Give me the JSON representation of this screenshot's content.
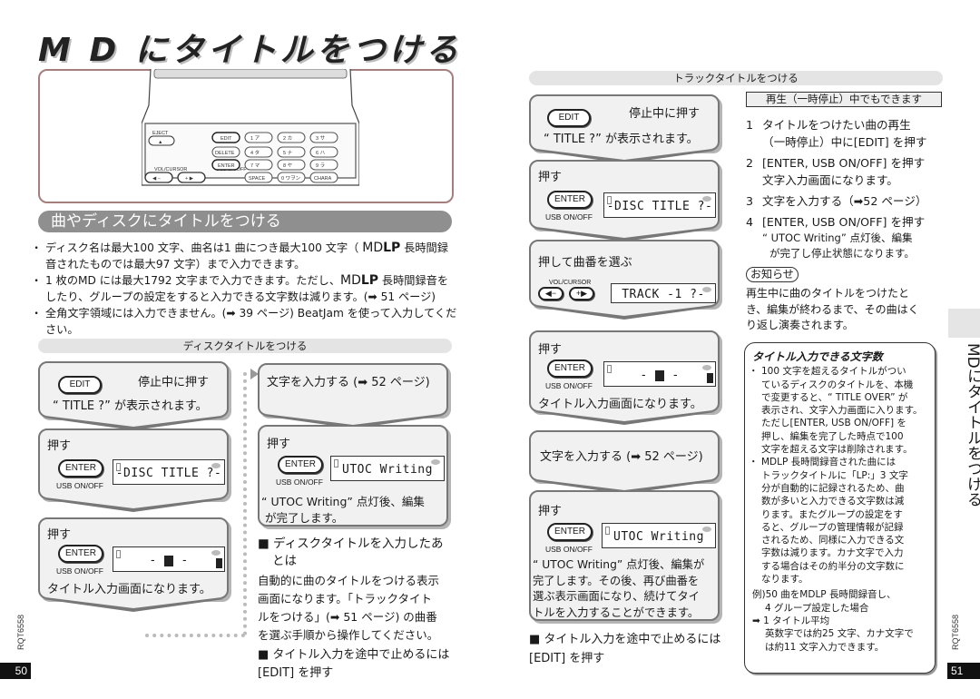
{
  "page_title": "M D にタイトルをつける",
  "device": {
    "eject_label": "EJECT",
    "vol_cursor_label": "VOL/CURSOR",
    "usb_label": "USB ON/OFF",
    "keys_row1": [
      "EDIT",
      "1 ア",
      "2 カ ABC",
      "3 サ DEF"
    ],
    "keys_row2": [
      "DELETE",
      "4 タ GHI",
      "5 ナ JKL",
      "6 ハ MNO"
    ],
    "keys_row3": [
      "ENTER",
      "7 マ PQRS",
      "8 ヤ TUV",
      "9 ラ WXYZ"
    ],
    "keys_row4": [
      "SPACE",
      "0 ワヲン",
      "CHARA"
    ],
    "cursor_keys": [
      "◀ −",
      "+ ▶"
    ]
  },
  "section": {
    "title": "曲やディスクにタイトルをつける",
    "bullets": [
      {
        "pre": "ディスク名は最大100 文字、曲名は1 曲につき最大100 文字（ ",
        "mdlp": "MD",
        "lp": "LP",
        "post": " 長時間録音されたものでは最大97 文字）まで入力できます。"
      },
      {
        "pre": "1 枚のMD には最大1792 文字まで入力できます。ただし、",
        "mdlp": "MD",
        "lp": "LP",
        "post": " 長時間録音をしたり、グループの設定をすると入力できる文字数は減ります。(➡ 51 ページ)"
      },
      {
        "pre": "全角文字領域には入力できません。(➡ 39 ページ) BeatJam を使って入力してください。",
        "mdlp": "",
        "lp": "",
        "post": ""
      }
    ]
  },
  "disc": {
    "header": "ディスクタイトルをつける",
    "step1": {
      "button": "EDIT",
      "action": "停止中に押す",
      "result": "“ TITLE ?” が表示されます。"
    },
    "step2": {
      "label": "押す",
      "button": "ENTER",
      "sub": "USB ON/OFF",
      "lcd": "-DISC TITLE ?-"
    },
    "step3": {
      "label": "押す",
      "button": "ENTER",
      "sub": "USB ON/OFF",
      "result": "タイトル入力画面になります。"
    },
    "step4": {
      "text": "文字を入力する (➡ 52 ページ)"
    },
    "step5": {
      "label": "押す",
      "button": "ENTER",
      "sub": "USB ON/OFF",
      "lcd": "UTOC Writing",
      "result1": "“ UTOC Writing” 点灯後、編集",
      "result2": "が完了します。"
    },
    "after_title1": "■ ディスクタイトルを入力したあ",
    "after_title2": "とは",
    "after_body": [
      "自動的に曲のタイトルをつける表示",
      "画面になります。「トラックタイト",
      "ルをつける」(➡ 51 ページ) の曲番",
      "を選ぶ手順から操作してください。"
    ],
    "stop_title": "■ タイトル入力を途中で止めるには",
    "stop_body": "[EDIT] を押す"
  },
  "track": {
    "header": "トラックタイトルをつける",
    "step1": {
      "button": "EDIT",
      "action": "停止中に押す",
      "result": "“ TITLE ?” が表示されます。"
    },
    "step2": {
      "label": "押す",
      "button": "ENTER",
      "sub": "USB ON/OFF",
      "lcd": "-DISC TITLE ?-"
    },
    "step3": {
      "label": "押して曲番を選ぶ",
      "sub": "VOL/CURSOR",
      "lcd": "TRACK -1 ?-"
    },
    "step4": {
      "label": "押す",
      "button": "ENTER",
      "sub": "USB ON/OFF",
      "result": "タイトル入力画面になります。"
    },
    "step5": {
      "text": "文字を入力する (➡ 52 ページ)"
    },
    "step6": {
      "label": "押す",
      "button": "ENTER",
      "sub": "USB ON/OFF",
      "lcd": "UTOC Writing",
      "result": [
        "“ UTOC Writing” 点灯後、編集が",
        "完了します。その後、再び曲番を",
        "選ぶ表示画面になり、続けてタイ",
        "トルを入力することができます。"
      ]
    },
    "stop_title": "■ タイトル入力を途中で止めるには",
    "stop_body": "[EDIT] を押す"
  },
  "playback": {
    "label": "再生（一時停止）中でもできます",
    "steps": [
      {
        "n": "1",
        "text": "タイトルをつけたい曲の再生",
        "cont": "（一時停止）中に[EDIT] を押す"
      },
      {
        "n": "2",
        "text": "[ENTER, USB ON/OFF] を押す",
        "cont": "文字入力画面になります。"
      },
      {
        "n": "3",
        "text": "文字を入力する（➡52 ページ）",
        "cont": ""
      },
      {
        "n": "4",
        "text": "[ENTER, USB ON/OFF] を押す",
        "cont": "“ UTOC Writing” 点灯後、編集",
        "cont2": "が完了し停止状態になります。"
      }
    ],
    "notice_label": "お知らせ",
    "notice_body": [
      "再生中に曲のタイトルをつけたと",
      "き、編集が終わるまで、その曲はく",
      "り返し演奏されます。"
    ]
  },
  "info": {
    "title": "タイトル入力できる文字数",
    "items": [
      [
        "100 文字を超えるタイトルがつい",
        "ているディスクのタイトルを、本機",
        "で変更すると、“ TITLE OVER” が",
        "表示され、文字入力画面に入ります。",
        "ただし[ENTER, USB ON/OFF] を",
        "押し、編集を完了した時点で100",
        "文字を超える文字は削除されます。"
      ],
      [
        "MDLP 長時間録音された曲には",
        "トラックタイトルに「LP:」3 文字",
        "分が自動的に記録されるため、曲",
        "数が多いと入力できる文字数は減",
        "ります。またグループの設定をす",
        "ると、グループの管理情報が記録",
        "されるため、同様に入力できる文",
        "字数は減ります。カナ文字で入力",
        "する場合はその約半分の文字数に",
        "なります。"
      ]
    ],
    "example": [
      "例)50 曲をMDLP 長時間録音し、",
      "4 グループ設定した場合",
      "➡ 1 タイトル平均",
      "英数字では約25 文字、カナ文字で",
      "は約11 文字入力できます。"
    ]
  },
  "side_title": "MDにタイトルをつける",
  "model_code": "RQT6558",
  "page_left": "50",
  "page_right": "51"
}
